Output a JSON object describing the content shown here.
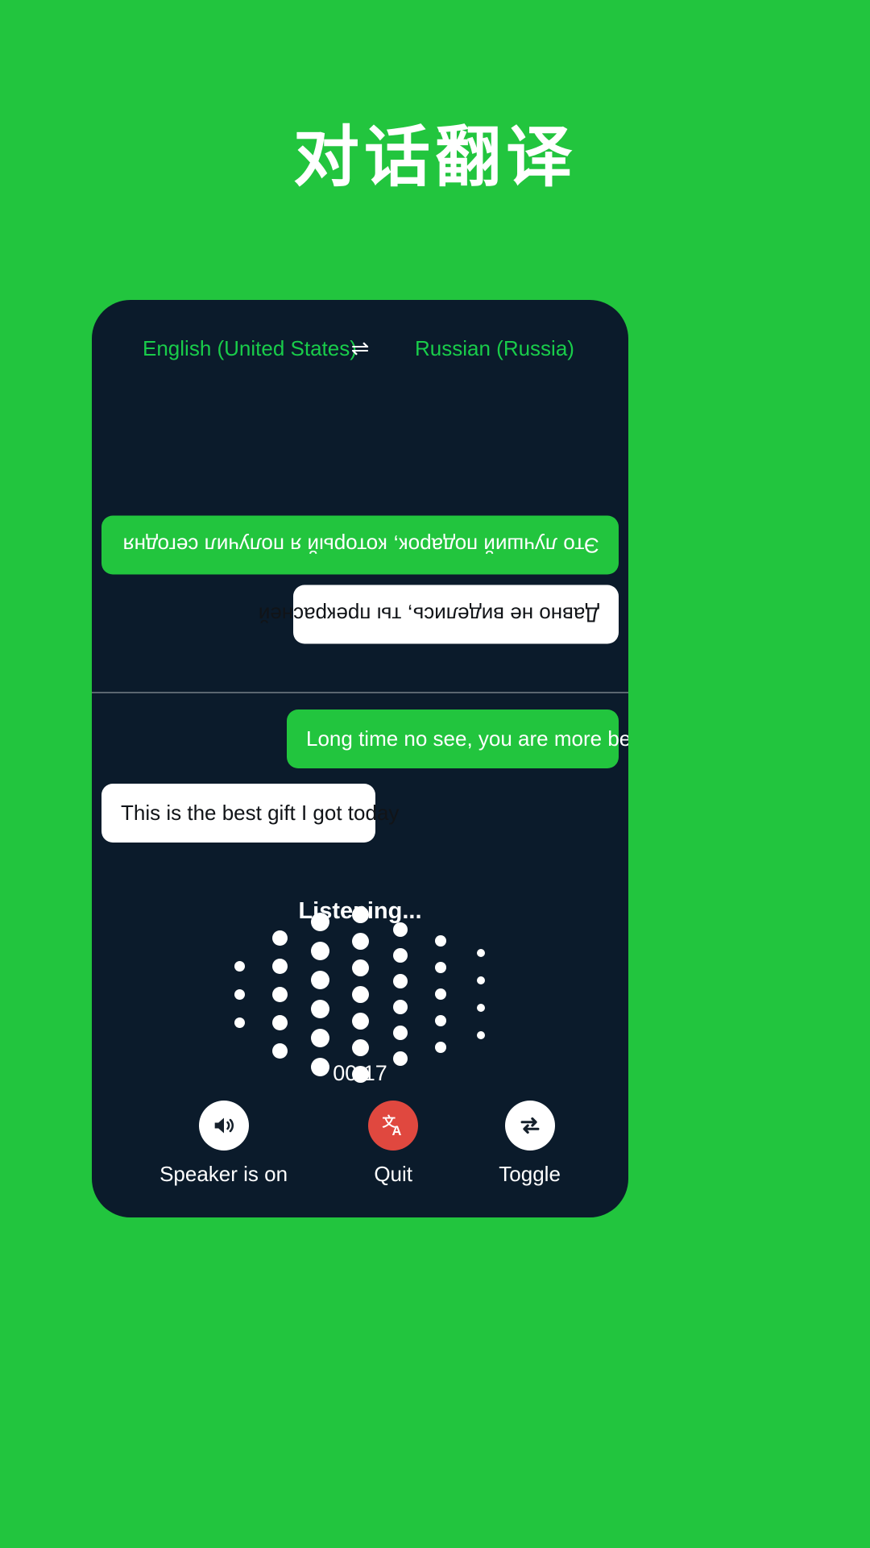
{
  "page": {
    "title": "对话翻译",
    "background_color": "#22c53e",
    "card_color": "#0b1b2b"
  },
  "language_bar": {
    "source": "English (United States)",
    "swap_icon": "swap-horizontal-icon",
    "swap_glyph": "⇌",
    "target": "Russian (Russia)",
    "text_color": "#19cc4a"
  },
  "conversation": {
    "remote": [
      {
        "text": "Это лучший подарок, который я получил сегодня",
        "style": "green",
        "rotated": true
      },
      {
        "text": "Давно не виделись, ты прекрасней",
        "style": "white",
        "rotated": true
      }
    ],
    "local": [
      {
        "text": "Long time no see, you are more beautiful",
        "style": "green",
        "rotated": false
      },
      {
        "text": "This is the best gift I got today",
        "style": "white",
        "rotated": false
      }
    ]
  },
  "status": {
    "listening_label": "Listening...",
    "timer": "00:17"
  },
  "visualizer": {
    "columns": [
      {
        "dots": 3,
        "size": 13,
        "gap": 22
      },
      {
        "dots": 5,
        "size": 19,
        "gap": 16
      },
      {
        "dots": 6,
        "size": 23,
        "gap": 13
      },
      {
        "dots": 7,
        "size": 21,
        "gap": 12
      },
      {
        "dots": 6,
        "size": 18,
        "gap": 14
      },
      {
        "dots": 5,
        "size": 14,
        "gap": 19
      },
      {
        "dots": 4,
        "size": 10,
        "gap": 24
      }
    ],
    "dot_color": "#ffffff"
  },
  "controls": [
    {
      "label": "Speaker is on",
      "icon": "speaker-on-icon",
      "circle": "light",
      "name": "speaker-toggle-button"
    },
    {
      "label": "Quit",
      "icon": "translate-icon",
      "circle": "danger",
      "name": "quit-button"
    },
    {
      "label": "Toggle",
      "icon": "swap-arrows-icon",
      "circle": "light",
      "name": "toggle-button"
    }
  ]
}
